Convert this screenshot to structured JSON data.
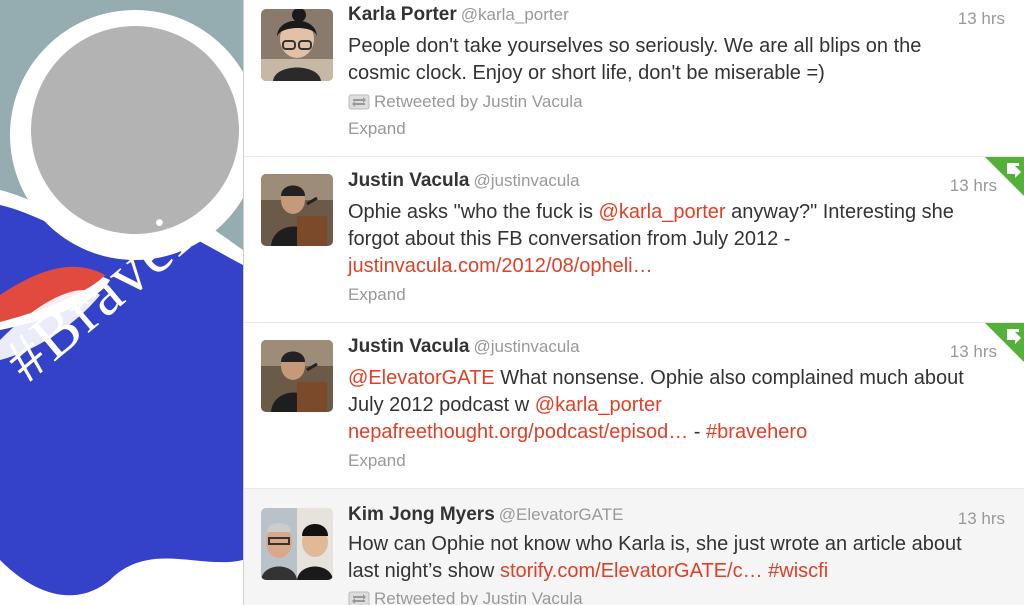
{
  "background": {
    "text": "#Bravei"
  },
  "tweets": [
    {
      "name": "Karla Porter",
      "handle": "@karla_porter",
      "time": "13 hrs",
      "text_parts": [
        "People don't take yourselves so seriously. We are all blips on the cosmic clock. Enjoy or short life, don't be miserable =)"
      ],
      "retweeted_by": "Retweeted by Justin Vacula",
      "expand": "Expand"
    },
    {
      "name": "Justin Vacula",
      "handle": "@justinvacula",
      "time": "13 hrs",
      "text_parts": [
        "Ophie asks \"who the fuck is ",
        "@karla_porter",
        " anyway?\" Interesting she forgot about this FB conversation from July 2012 - ",
        "justinvacula.com/2012/08/opheli…"
      ],
      "expand": "Expand"
    },
    {
      "name": "Justin Vacula",
      "handle": "@justinvacula",
      "time": "13 hrs",
      "text_parts": [
        "@ElevatorGATE",
        " What nonsense. Ophie also complained much about July 2012 podcast w ",
        "@karla_porter",
        " ",
        "nepafreethought.org/podcast/episod…",
        " - ",
        "#bravehero"
      ],
      "expand": "Expand"
    },
    {
      "name": "Kim Jong Myers",
      "handle": "@ElevatorGATE",
      "time": "13 hrs",
      "text_parts": [
        "How can Ophie not know who Karla is, she just wrote an article about last night’s show ",
        "storify.com/ElevatorGATE/c…",
        " ",
        "#wiscfi"
      ],
      "retweeted_by": "Retweeted by Justin Vacula"
    }
  ],
  "colors": {
    "link": "#e04027",
    "favorite": "#55b03a",
    "background_blue": "#3442c9",
    "background_gray": "#95adb0"
  }
}
